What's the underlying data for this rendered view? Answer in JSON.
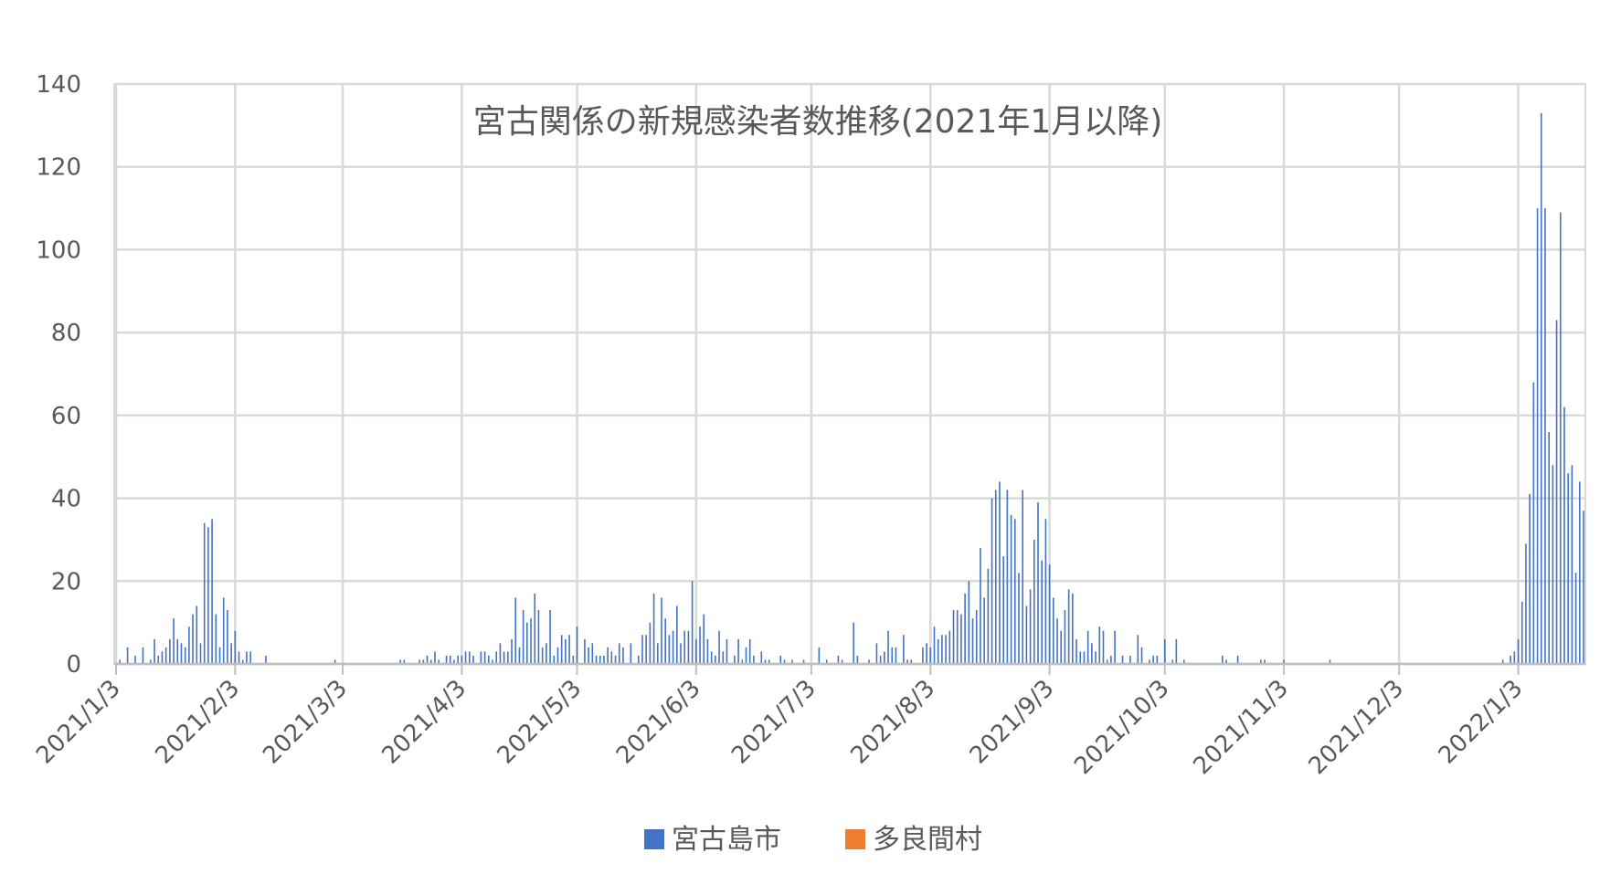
{
  "chart_data": {
    "type": "bar",
    "title": "宮古関係の新規感染者数推移(2021年1月以降)",
    "xlabel": "",
    "ylabel": "",
    "ylim": [
      0,
      140
    ],
    "yticks": [
      0,
      20,
      40,
      60,
      80,
      100,
      120,
      140
    ],
    "xlim": [
      "2021-01-03",
      "2022-01-20"
    ],
    "x_tick_labels": [
      "2021/1/3",
      "2021/2/3",
      "2021/3/3",
      "2021/4/3",
      "2021/5/3",
      "2021/6/3",
      "2021/7/3",
      "2021/8/3",
      "2021/9/3",
      "2021/10/3",
      "2021/11/3",
      "2021/12/3",
      "2022/1/3"
    ],
    "x_tick_dates": [
      "2021-01-03",
      "2021-02-03",
      "2021-03-03",
      "2021-04-03",
      "2021-05-03",
      "2021-06-03",
      "2021-07-03",
      "2021-08-03",
      "2021-09-03",
      "2021-10-03",
      "2021-11-03",
      "2021-12-03",
      "2022-01-03"
    ],
    "grid": true,
    "legend_position": "bottom",
    "series": [
      {
        "name": "宮古島市",
        "color": "#4472C4",
        "points": [
          [
            "2021-01-04",
            1
          ],
          [
            "2021-01-06",
            4
          ],
          [
            "2021-01-08",
            2
          ],
          [
            "2021-01-10",
            4
          ],
          [
            "2021-01-12",
            1
          ],
          [
            "2021-01-13",
            6
          ],
          [
            "2021-01-14",
            2
          ],
          [
            "2021-01-15",
            3
          ],
          [
            "2021-01-16",
            4
          ],
          [
            "2021-01-17",
            6
          ],
          [
            "2021-01-18",
            11
          ],
          [
            "2021-01-19",
            6
          ],
          [
            "2021-01-20",
            5
          ],
          [
            "2021-01-21",
            4
          ],
          [
            "2021-01-22",
            9
          ],
          [
            "2021-01-23",
            12
          ],
          [
            "2021-01-24",
            14
          ],
          [
            "2021-01-25",
            5
          ],
          [
            "2021-01-26",
            34
          ],
          [
            "2021-01-27",
            33
          ],
          [
            "2021-01-28",
            35
          ],
          [
            "2021-01-29",
            12
          ],
          [
            "2021-01-30",
            4
          ],
          [
            "2021-01-31",
            16
          ],
          [
            "2021-02-01",
            13
          ],
          [
            "2021-02-02",
            5
          ],
          [
            "2021-02-03",
            8
          ],
          [
            "2021-02-04",
            3
          ],
          [
            "2021-02-05",
            1
          ],
          [
            "2021-02-06",
            3
          ],
          [
            "2021-02-07",
            3
          ],
          [
            "2021-02-11",
            2
          ],
          [
            "2021-03-01",
            1
          ],
          [
            "2021-03-18",
            1
          ],
          [
            "2021-03-19",
            1
          ],
          [
            "2021-03-23",
            1
          ],
          [
            "2021-03-24",
            1
          ],
          [
            "2021-03-25",
            2
          ],
          [
            "2021-03-26",
            1
          ],
          [
            "2021-03-27",
            3
          ],
          [
            "2021-03-28",
            1
          ],
          [
            "2021-03-30",
            2
          ],
          [
            "2021-03-31",
            2
          ],
          [
            "2021-04-01",
            1
          ],
          [
            "2021-04-02",
            2
          ],
          [
            "2021-04-03",
            2
          ],
          [
            "2021-04-04",
            3
          ],
          [
            "2021-04-05",
            3
          ],
          [
            "2021-04-06",
            2
          ],
          [
            "2021-04-08",
            3
          ],
          [
            "2021-04-09",
            3
          ],
          [
            "2021-04-10",
            2
          ],
          [
            "2021-04-11",
            1
          ],
          [
            "2021-04-12",
            3
          ],
          [
            "2021-04-13",
            5
          ],
          [
            "2021-04-14",
            3
          ],
          [
            "2021-04-15",
            3
          ],
          [
            "2021-04-16",
            6
          ],
          [
            "2021-04-17",
            16
          ],
          [
            "2021-04-18",
            4
          ],
          [
            "2021-04-19",
            13
          ],
          [
            "2021-04-20",
            10
          ],
          [
            "2021-04-21",
            11
          ],
          [
            "2021-04-22",
            17
          ],
          [
            "2021-04-23",
            13
          ],
          [
            "2021-04-24",
            4
          ],
          [
            "2021-04-25",
            5
          ],
          [
            "2021-04-26",
            13
          ],
          [
            "2021-04-27",
            2
          ],
          [
            "2021-04-28",
            4
          ],
          [
            "2021-04-29",
            7
          ],
          [
            "2021-04-30",
            6
          ],
          [
            "2021-05-01",
            7
          ],
          [
            "2021-05-02",
            2
          ],
          [
            "2021-05-03",
            9
          ],
          [
            "2021-05-05",
            6
          ],
          [
            "2021-05-06",
            4
          ],
          [
            "2021-05-07",
            5
          ],
          [
            "2021-05-08",
            2
          ],
          [
            "2021-05-09",
            2
          ],
          [
            "2021-05-10",
            2
          ],
          [
            "2021-05-11",
            4
          ],
          [
            "2021-05-12",
            3
          ],
          [
            "2021-05-13",
            2
          ],
          [
            "2021-05-14",
            5
          ],
          [
            "2021-05-15",
            4
          ],
          [
            "2021-05-17",
            5
          ],
          [
            "2021-05-19",
            2
          ],
          [
            "2021-05-20",
            7
          ],
          [
            "2021-05-21",
            7
          ],
          [
            "2021-05-22",
            10
          ],
          [
            "2021-05-23",
            17
          ],
          [
            "2021-05-24",
            5
          ],
          [
            "2021-05-25",
            16
          ],
          [
            "2021-05-26",
            11
          ],
          [
            "2021-05-27",
            7
          ],
          [
            "2021-05-28",
            8
          ],
          [
            "2021-05-29",
            14
          ],
          [
            "2021-05-30",
            5
          ],
          [
            "2021-05-31",
            8
          ],
          [
            "2021-06-01",
            8
          ],
          [
            "2021-06-02",
            20
          ],
          [
            "2021-06-03",
            6
          ],
          [
            "2021-06-04",
            9
          ],
          [
            "2021-06-05",
            12
          ],
          [
            "2021-06-06",
            6
          ],
          [
            "2021-06-07",
            3
          ],
          [
            "2021-06-08",
            2
          ],
          [
            "2021-06-09",
            8
          ],
          [
            "2021-06-10",
            3
          ],
          [
            "2021-06-11",
            6
          ],
          [
            "2021-06-13",
            2
          ],
          [
            "2021-06-14",
            6
          ],
          [
            "2021-06-15",
            1
          ],
          [
            "2021-06-16",
            4
          ],
          [
            "2021-06-17",
            6
          ],
          [
            "2021-06-18",
            2
          ],
          [
            "2021-06-20",
            3
          ],
          [
            "2021-06-21",
            1
          ],
          [
            "2021-06-22",
            1
          ],
          [
            "2021-06-25",
            2
          ],
          [
            "2021-06-26",
            1
          ],
          [
            "2021-06-28",
            1
          ],
          [
            "2021-07-01",
            1
          ],
          [
            "2021-07-05",
            4
          ],
          [
            "2021-07-07",
            1
          ],
          [
            "2021-07-10",
            2
          ],
          [
            "2021-07-11",
            1
          ],
          [
            "2021-07-14",
            10
          ],
          [
            "2021-07-15",
            2
          ],
          [
            "2021-07-18",
            1
          ],
          [
            "2021-07-20",
            5
          ],
          [
            "2021-07-21",
            2
          ],
          [
            "2021-07-22",
            3
          ],
          [
            "2021-07-23",
            8
          ],
          [
            "2021-07-24",
            4
          ],
          [
            "2021-07-25",
            4
          ],
          [
            "2021-07-27",
            7
          ],
          [
            "2021-07-28",
            1
          ],
          [
            "2021-07-29",
            1
          ],
          [
            "2021-08-01",
            4
          ],
          [
            "2021-08-02",
            5
          ],
          [
            "2021-08-03",
            4
          ],
          [
            "2021-08-04",
            9
          ],
          [
            "2021-08-05",
            6
          ],
          [
            "2021-08-06",
            7
          ],
          [
            "2021-08-07",
            7
          ],
          [
            "2021-08-08",
            8
          ],
          [
            "2021-08-09",
            13
          ],
          [
            "2021-08-10",
            13
          ],
          [
            "2021-08-11",
            12
          ],
          [
            "2021-08-12",
            17
          ],
          [
            "2021-08-13",
            20
          ],
          [
            "2021-08-14",
            11
          ],
          [
            "2021-08-15",
            13
          ],
          [
            "2021-08-16",
            28
          ],
          [
            "2021-08-17",
            16
          ],
          [
            "2021-08-18",
            23
          ],
          [
            "2021-08-19",
            40
          ],
          [
            "2021-08-20",
            42
          ],
          [
            "2021-08-21",
            44
          ],
          [
            "2021-08-22",
            26
          ],
          [
            "2021-08-23",
            42
          ],
          [
            "2021-08-24",
            36
          ],
          [
            "2021-08-25",
            35
          ],
          [
            "2021-08-26",
            22
          ],
          [
            "2021-08-27",
            42
          ],
          [
            "2021-08-28",
            14
          ],
          [
            "2021-08-29",
            18
          ],
          [
            "2021-08-30",
            30
          ],
          [
            "2021-08-31",
            39
          ],
          [
            "2021-09-01",
            25
          ],
          [
            "2021-09-02",
            35
          ],
          [
            "2021-09-03",
            24
          ],
          [
            "2021-09-04",
            16
          ],
          [
            "2021-09-05",
            11
          ],
          [
            "2021-09-06",
            8
          ],
          [
            "2021-09-07",
            13
          ],
          [
            "2021-09-08",
            18
          ],
          [
            "2021-09-09",
            17
          ],
          [
            "2021-09-10",
            6
          ],
          [
            "2021-09-11",
            3
          ],
          [
            "2021-09-12",
            3
          ],
          [
            "2021-09-13",
            8
          ],
          [
            "2021-09-14",
            5
          ],
          [
            "2021-09-15",
            3
          ],
          [
            "2021-09-16",
            9
          ],
          [
            "2021-09-17",
            8
          ],
          [
            "2021-09-18",
            1
          ],
          [
            "2021-09-19",
            2
          ],
          [
            "2021-09-20",
            8
          ],
          [
            "2021-09-22",
            2
          ],
          [
            "2021-09-24",
            2
          ],
          [
            "2021-09-26",
            7
          ],
          [
            "2021-09-27",
            4
          ],
          [
            "2021-09-29",
            1
          ],
          [
            "2021-09-30",
            2
          ],
          [
            "2021-10-01",
            2
          ],
          [
            "2021-10-03",
            6
          ],
          [
            "2021-10-05",
            1
          ],
          [
            "2021-10-06",
            6
          ],
          [
            "2021-10-08",
            1
          ],
          [
            "2021-10-18",
            2
          ],
          [
            "2021-10-19",
            1
          ],
          [
            "2021-10-22",
            2
          ],
          [
            "2021-10-28",
            1
          ],
          [
            "2021-10-29",
            1
          ],
          [
            "2021-11-03",
            1
          ],
          [
            "2021-11-15",
            1
          ],
          [
            "2021-12-30",
            1
          ],
          [
            "2022-01-01",
            2
          ],
          [
            "2022-01-02",
            3
          ],
          [
            "2022-01-03",
            6
          ],
          [
            "2022-01-04",
            15
          ],
          [
            "2022-01-05",
            29
          ],
          [
            "2022-01-06",
            41
          ],
          [
            "2022-01-07",
            68
          ],
          [
            "2022-01-08",
            110
          ],
          [
            "2022-01-09",
            133
          ],
          [
            "2022-01-10",
            110
          ],
          [
            "2022-01-11",
            56
          ],
          [
            "2022-01-12",
            48
          ],
          [
            "2022-01-13",
            83
          ],
          [
            "2022-01-14",
            109
          ],
          [
            "2022-01-15",
            62
          ],
          [
            "2022-01-16",
            46
          ],
          [
            "2022-01-17",
            48
          ],
          [
            "2022-01-18",
            22
          ],
          [
            "2022-01-19",
            44
          ],
          [
            "2022-01-20",
            37
          ]
        ]
      },
      {
        "name": "多良間村",
        "color": "#ED7D31",
        "points": []
      }
    ]
  }
}
